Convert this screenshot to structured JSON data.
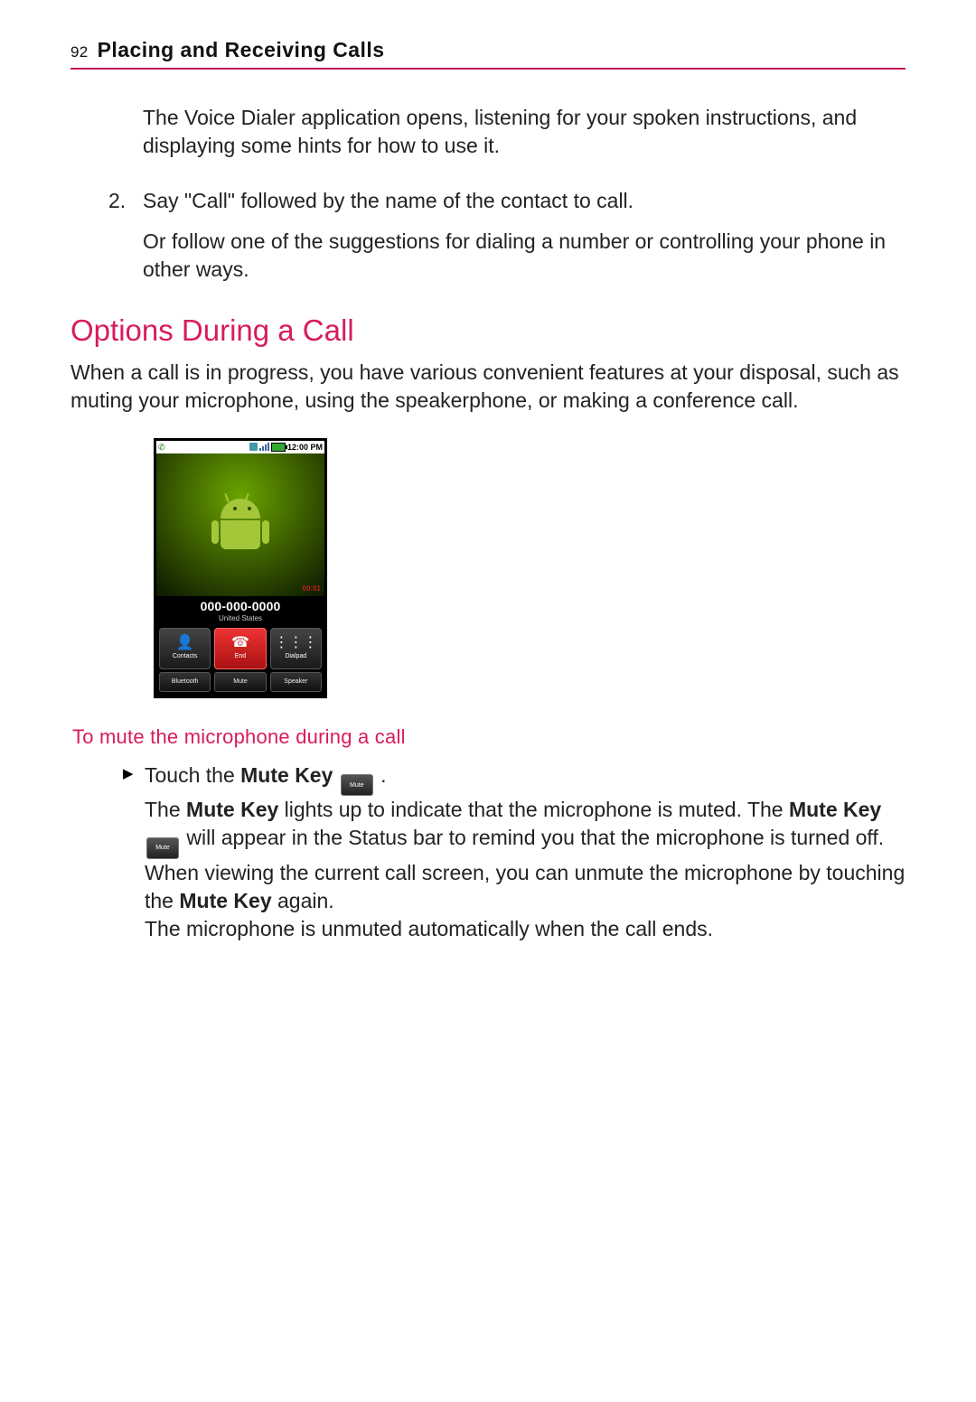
{
  "page_number": "92",
  "page_title": "Placing and Receiving Calls",
  "intro_para": "The Voice Dialer application opens, listening for your spoken instructions, and displaying some hints for how to use it.",
  "step2_num": "2.",
  "step2_text": "Say \"Call\" followed by the name of the contact to call.",
  "step2_follow": "Or follow one of the suggestions for dialing a number or controlling your phone in other ways.",
  "section_heading": "Options During a Call",
  "section_para": "When a call is in progress, you have various convenient features at your disposal, such as muting your microphone, using the speakerphone, or making a conference call.",
  "phone": {
    "time": "12:00 PM",
    "call_timer": "00:01",
    "number": "000-000-0000",
    "location": "United States",
    "btn_contacts": "Contacts",
    "btn_end": "End",
    "btn_dialpad": "Dialpad",
    "btn_bluetooth": "Bluetooth",
    "btn_mute": "Mute",
    "btn_speaker": "Speaker"
  },
  "sub_heading": "To mute the microphone during a call",
  "bullet": {
    "line1_a": "Touch the ",
    "mute_key_bold": "Mute Key",
    "line1_b": " .",
    "line2_a": "The ",
    "line2_b": " lights up to indicate that the microphone is muted. The ",
    "line2_c": " will appear in the Status bar to remind you that the microphone is turned off.",
    "line3": "When viewing the current call screen, you can unmute the microphone by touching the ",
    "line3_b": " again.",
    "line4": "The microphone is unmuted automatically when the call ends."
  },
  "mute_chip_label": "Mute"
}
